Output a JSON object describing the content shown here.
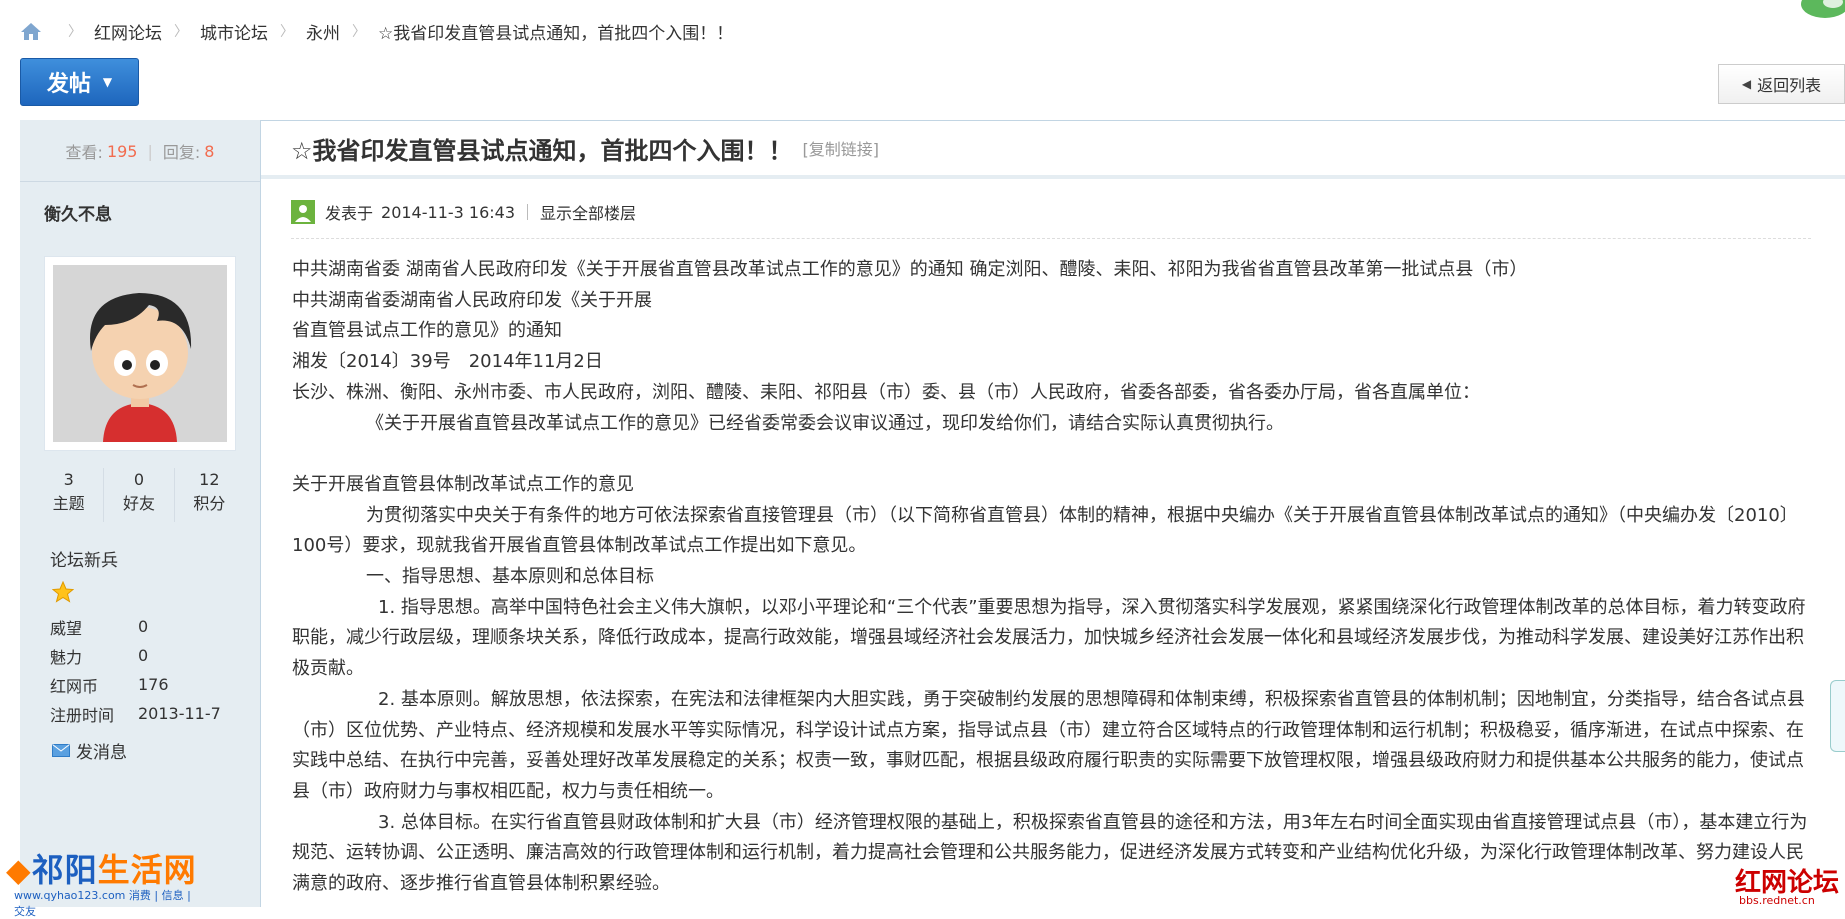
{
  "breadcrumb": {
    "items": [
      "红网论坛",
      "城市论坛",
      "永州"
    ],
    "current": "☆我省印发直管县试点通知，首批四个入围！！"
  },
  "toolbar": {
    "post_label": "发帖",
    "back_label": "返回列表"
  },
  "stats": {
    "views_label": "查看:",
    "views": "195",
    "replies_label": "回复:",
    "replies": "8"
  },
  "author": {
    "name": "衡久不息",
    "counts": [
      {
        "value": "3",
        "label": "主题"
      },
      {
        "value": "0",
        "label": "好友"
      },
      {
        "value": "12",
        "label": "积分"
      }
    ],
    "rank": "论坛新兵",
    "info": [
      {
        "key": "威望",
        "value": "0"
      },
      {
        "key": "魅力",
        "value": "0"
      },
      {
        "key": "红网币",
        "value": "176"
      },
      {
        "key": "注册时间",
        "value": "2013-11-7"
      }
    ],
    "message_label": "发消息"
  },
  "post": {
    "title": "☆我省印发直管县试点通知，首批四个入围！！",
    "copy_link": "[复制链接]",
    "posted_label": "发表于",
    "posted_time": "2014-11-3 16:43",
    "show_all": "显示全部楼层",
    "paragraphs": [
      {
        "text": "中共湖南省委 湖南省人民政府印发《关于开展省直管县改革试点工作的意见》的通知 确定浏阳、醴陵、耒阳、祁阳为我省省直管县改革第一批试点县（市）",
        "style": ""
      },
      {
        "text": "中共湖南省委湖南省人民政府印发《关于开展",
        "style": ""
      },
      {
        "text": "省直管县试点工作的意见》的通知",
        "style": ""
      },
      {
        "text": "湘发〔2014〕39号　2014年11月2日",
        "style": ""
      },
      {
        "text": "长沙、株洲、衡阳、永州市委、市人民政府，浏阳、醴陵、耒阳、祁阳县（市）委、县（市）人民政府，省委各部委，省各委办厅局，省各直属单位：",
        "style": ""
      },
      {
        "text": "《关于开展省直管县改革试点工作的意见》已经省委常委会议审议通过，现印发给你们，请结合实际认真贯彻执行。",
        "style": "ind"
      },
      {
        "text": "",
        "style": "blank"
      },
      {
        "text": "关于开展省直管县体制改革试点工作的意见",
        "style": ""
      },
      {
        "text": "为贯彻落实中央关于有条件的地方可依法探索省直接管理县（市）（以下简称省直管县）体制的精神，根据中央编办《关于开展省直管县体制改革试点的通知》（中央编办发〔2010〕100号）要求，现就我省开展省直管县体制改革试点工作提出如下意见。",
        "style": "ind"
      },
      {
        "text": "一、指导思想、基本原则和总体目标",
        "style": "ind"
      },
      {
        "text": "1. 指导思想。高举中国特色社会主义伟大旗帜，以邓小平理论和“三个代表”重要思想为指导，深入贯彻落实科学发展观，紧紧围绕深化行政管理体制改革的总体目标，着力转变政府职能，减少行政层级，理顺条块关系，降低行政成本，提高行政效能，增强县域经济社会发展活力，加快城乡经济社会发展一体化和县域经济发展步伐，为推动科学发展、建设美好江苏作出积极贡献。",
        "style": "ind2"
      },
      {
        "text": "2. 基本原则。解放思想，依法探索，在宪法和法律框架内大胆实践，勇于突破制约发展的思想障碍和体制束缚，积极探索省直管县的体制机制；因地制宜，分类指导，结合各试点县（市）区位优势、产业特点、经济规模和发展水平等实际情况，科学设计试点方案，指导试点县（市）建立符合区域特点的行政管理体制和运行机制；积极稳妥，循序渐进，在试点中探索、在实践中总结、在执行中完善，妥善处理好改革发展稳定的关系；权责一致，事财匹配，根据县级政府履行职责的实际需要下放管理权限，增强县级政府财力和提供基本公共服务的能力，使试点县（市）政府财力与事权相匹配，权力与责任相统一。",
        "style": "ind2"
      },
      {
        "text": "3. 总体目标。在实行省直管县财政体制和扩大县（市）经济管理权限的基础上，积极探索省直管县的途径和方法，用3年左右时间全面实现由省直接管理试点县（市），基本建立行为规范、运转协调、公正透明、廉洁高效的行政管理体制和运行机制，着力提高社会管理和公共服务能力，促进经济发展方式转变和产业结构优化升级，为深化行政管理体制改革、努力建设人民满意的政府、逐步推行省直管县体制积累经验。",
        "style": "ind2"
      }
    ]
  },
  "watermarks": {
    "left_main_a": "祁阳",
    "left_main_b": "生活网",
    "left_sub": "www.qyhao123.com 消费 | 信息 | 交友",
    "right_main": "红网论坛",
    "right_sub": "bbs.rednet.cn"
  },
  "colors": {
    "accent_blue": "#2a76cf",
    "sidebar_bg": "#e5edf2",
    "stat_number": "#f26c4f"
  }
}
